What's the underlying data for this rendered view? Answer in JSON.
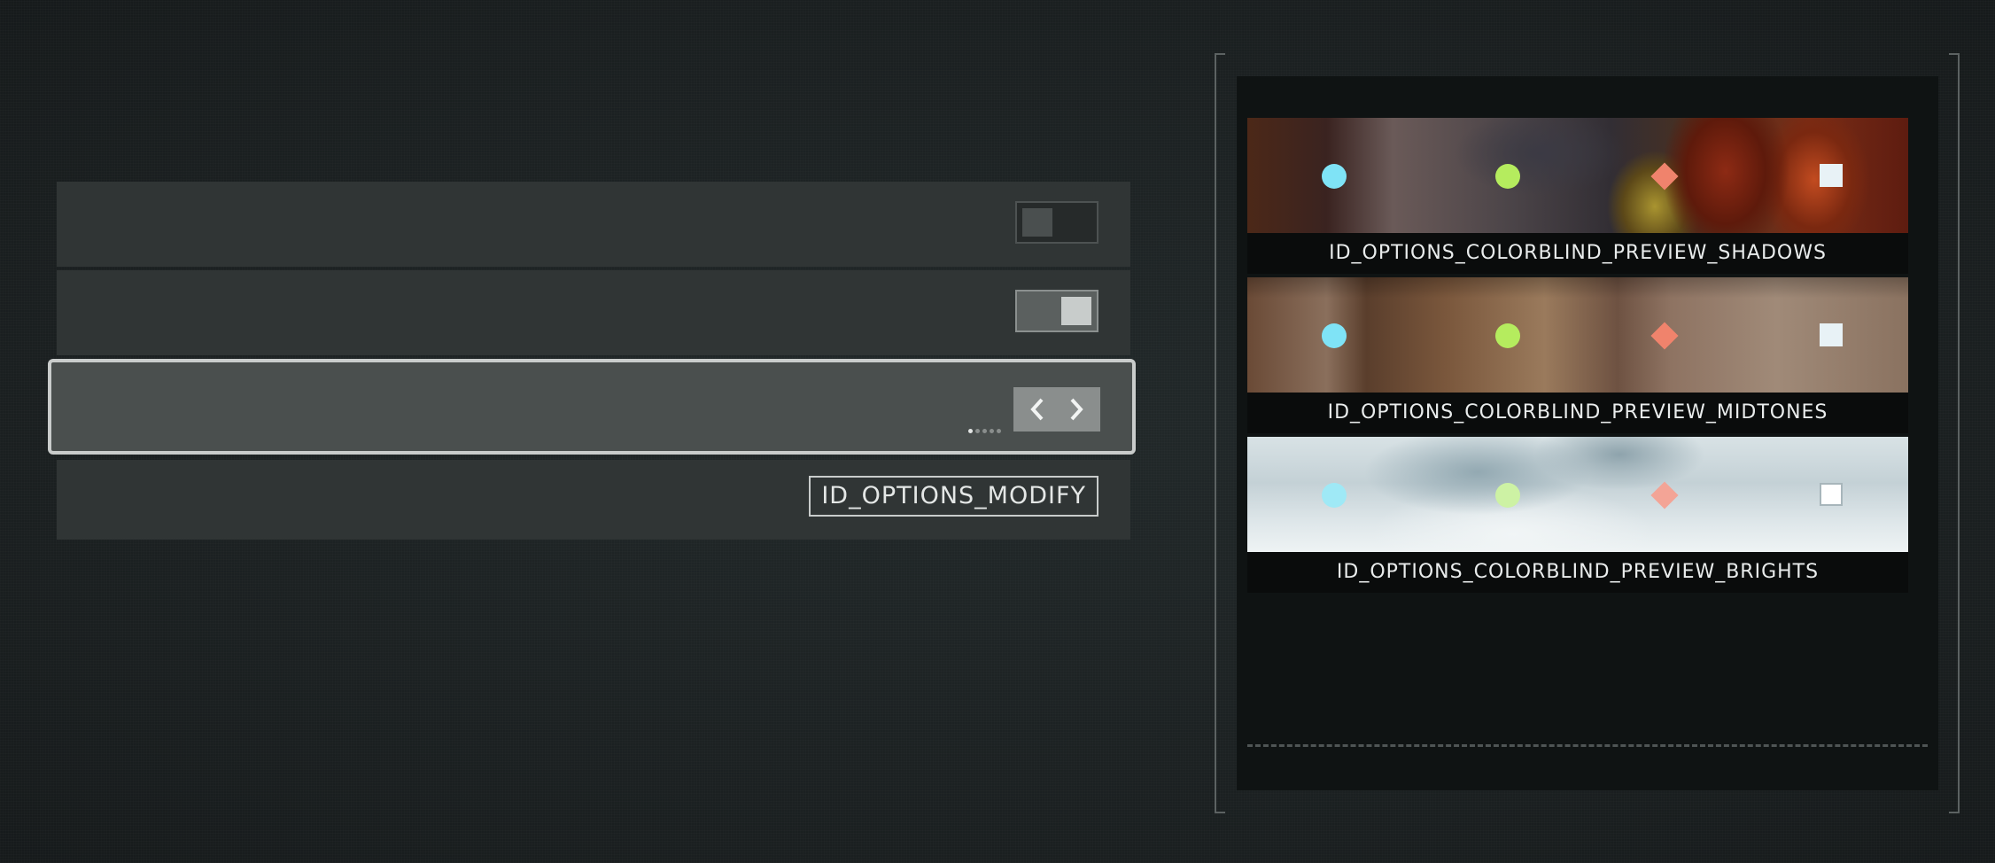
{
  "settings": {
    "rows": [
      {
        "control": "toggle",
        "state": "off"
      },
      {
        "control": "toggle",
        "state": "on"
      },
      {
        "control": "stepper",
        "selected": true,
        "pages": 5,
        "active_page": 1
      }
    ],
    "modify_label": "ID_OPTIONS_MODIFY"
  },
  "preview": {
    "items": [
      {
        "caption": "ID_OPTIONS_COLORBLIND_PREVIEW_SHADOWS"
      },
      {
        "caption": "ID_OPTIONS_COLORBLIND_PREVIEW_MIDTONES"
      },
      {
        "caption": "ID_OPTIONS_COLORBLIND_PREVIEW_BRIGHTS"
      }
    ],
    "marker_colors": {
      "circle_cyan": "#7fe3f6",
      "circle_green": "#b5ec5e",
      "diamond_salmon": "#f0836c",
      "square_white": "#e8f2f6"
    }
  },
  "colors": {
    "row_bg": "#303535",
    "selected_row_bg": "#4a4f4e",
    "selected_border": "#c9cccb",
    "panel_bg": "#0f1313"
  }
}
